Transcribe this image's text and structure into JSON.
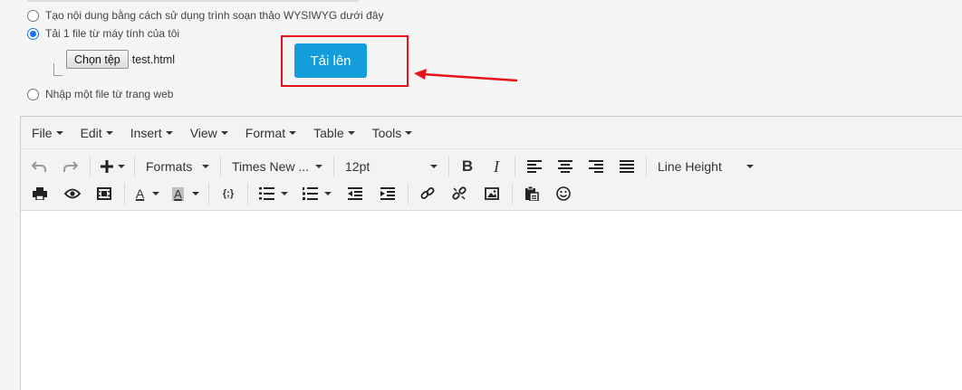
{
  "options": {
    "wysiwyg_label": "Tạo nội dung bằng cách sử dụng trình soạn thảo WYSIWYG dưới đây",
    "upload_label": "Tải 1 file từ máy tính của tôi",
    "web_label": "Nhập một file từ trang web",
    "selected": "upload"
  },
  "file_input": {
    "choose_label": "Chọn tệp",
    "file_name": "test.html"
  },
  "upload_button": {
    "label": "Tải lên",
    "color": "#139edb"
  },
  "highlight_color": "#e8121a",
  "menubar": [
    "File",
    "Edit",
    "Insert",
    "View",
    "Format",
    "Table",
    "Tools"
  ],
  "toolbar": {
    "formats": "Formats",
    "font_family": "Times New ...",
    "font_size": "12pt",
    "line_height": "Line Height",
    "bold": "B",
    "italic": "I",
    "code": "{;}",
    "text_color": "A",
    "bg_color": "A"
  }
}
